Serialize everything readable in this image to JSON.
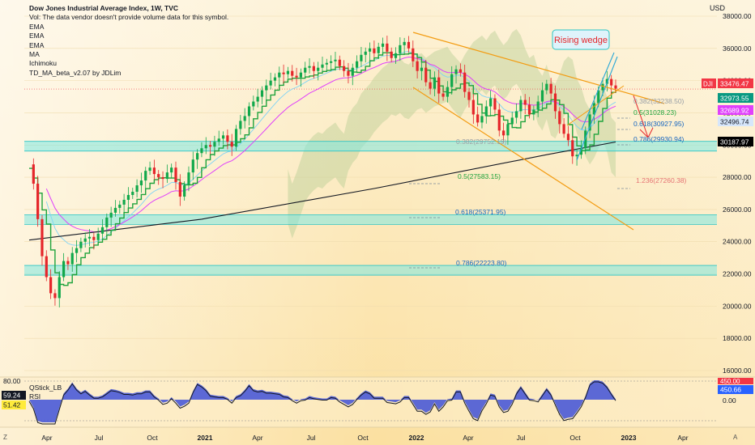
{
  "header": {
    "title": "Dow Jones Industrial Average Index, 1W, TVC",
    "vol_note": "Vol: The data vendor doesn't provide volume data for this symbol.",
    "indicators": [
      "EMA",
      "EMA",
      "EMA",
      "MA",
      "Ichimoku",
      "TD_MA_beta_v2.07 by JDLim"
    ],
    "currency": "USD"
  },
  "oscillator": {
    "labels": [
      "QStick_LB",
      "RSI"
    ],
    "scale_top": "80.00",
    "value_a": "59.24",
    "value_b": "51.42",
    "right_values": [
      "450.00",
      "450.66",
      "0.00"
    ]
  },
  "corner": {
    "left": "Z",
    "right": "A"
  },
  "chart_data": {
    "type": "candlestick",
    "symbol": "DJI",
    "ylim": [
      16000,
      38000
    ],
    "yticks": [
      "38000.00",
      "36000.00",
      "34000.00",
      "32000.00",
      "30000.00",
      "28000.00",
      "26000.00",
      "24000.00",
      "22000.00",
      "20000.00",
      "18000.00",
      "16000.00"
    ],
    "xticks": [
      "Apr",
      "Jul",
      "Oct",
      "2021",
      "Apr",
      "Jul",
      "Oct",
      "2022",
      "Apr",
      "Jul",
      "Oct",
      "2023",
      "Apr"
    ],
    "price_tags": [
      {
        "label": "DJI",
        "value": "33476.47",
        "color": "#f23645"
      },
      {
        "label": "",
        "value": "32973.55",
        "color": "#089981"
      },
      {
        "label": "",
        "value": "32689.92",
        "color": "#e040fb"
      },
      {
        "label": "",
        "value": "32496.74",
        "color": "#d6e6fb"
      },
      {
        "label": "",
        "value": "30187.97",
        "color": "#000000"
      }
    ],
    "annotations": [
      "Rising wedge"
    ],
    "fib_labels": [
      "0.382(32238.50)",
      "0.5(31028.23)",
      "0.618(30927.95)",
      "0.786(29930.94)",
      "0.382(29752.19)",
      "0.5(27583.15)",
      "1.236(27260.38)",
      "0.618(25371.95)",
      "0.786(22223.80)"
    ],
    "support_zones": [
      29930,
      25372,
      22224
    ],
    "closes": [
      28800,
      27600,
      25400,
      23100,
      21800,
      20800,
      20500,
      21800,
      22800,
      22600,
      23300,
      23600,
      24000,
      24200,
      24300,
      24100,
      24500,
      24900,
      25500,
      25800,
      26100,
      26300,
      26600,
      26900,
      27100,
      27500,
      27800,
      28400,
      28600,
      28200,
      28000,
      27900,
      28300,
      28600,
      27700,
      26800,
      27500,
      28300,
      29100,
      29500,
      29800,
      30000,
      29900,
      30200,
      30400,
      30600,
      30200,
      29900,
      31000,
      31500,
      31800,
      32400,
      32700,
      33000,
      33400,
      33700,
      34000,
      34200,
      34500,
      34400,
      34600,
      34300,
      34200,
      34500,
      34800,
      34900,
      34600,
      34800,
      35000,
      35100,
      35200,
      35300,
      34900,
      34600,
      34300,
      34800,
      35200,
      35600,
      35800,
      36000,
      35700,
      36100,
      36300,
      35800,
      35400,
      35700,
      36200,
      36400,
      36000,
      35200,
      34600,
      34800,
      33900,
      33500,
      34200,
      33200,
      33000,
      33600,
      34400,
      34700,
      34500,
      33300,
      32800,
      31900,
      31400,
      31800,
      32400,
      32900,
      32200,
      30900,
      30600,
      31300,
      31700,
      32100,
      32800,
      32500,
      31900,
      32200,
      32700,
      33400,
      33800,
      33200,
      32100,
      31300,
      30700,
      30300,
      29300,
      29400,
      29800,
      30900,
      31900,
      32600,
      33400,
      33800,
      34100,
      33700,
      33500
    ]
  }
}
